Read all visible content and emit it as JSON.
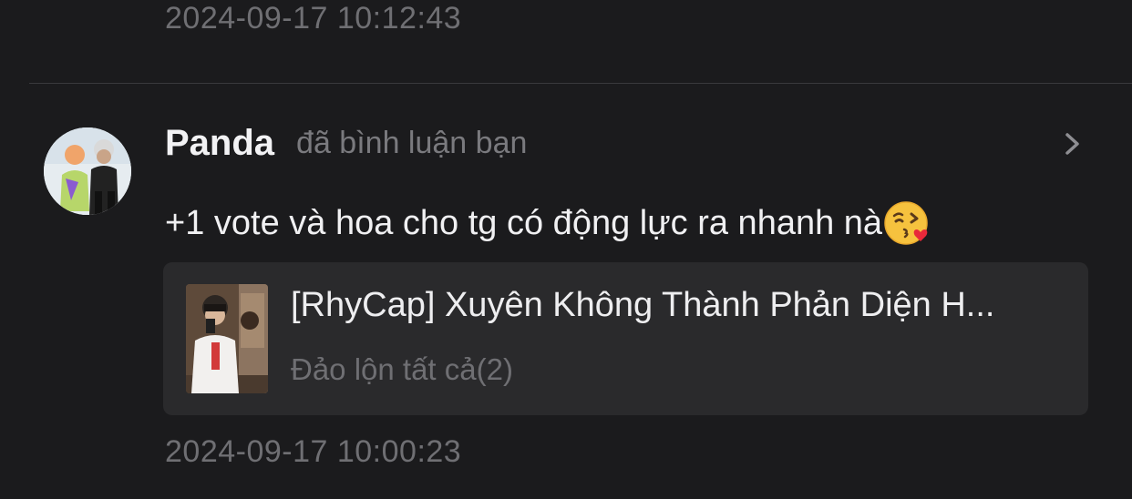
{
  "previous_notification": {
    "timestamp": "2024-09-17 10:12:43"
  },
  "notification": {
    "username": "Panda",
    "action_text": "đã bình luận bạn",
    "comment_text": "+1 vote và hoa cho tg có động lực ra nhanh nà",
    "comment_emoji": "kissing-face-with-heart-emoji",
    "timestamp": "2024-09-17 10:00:23",
    "avatar_icon": "user-avatar",
    "chevron_icon": "chevron-right-icon"
  },
  "story_card": {
    "title": "[RhyCap] Xuyên Không Thành Phản Diện H...",
    "subtitle": "Đảo lộn tất cả(2)",
    "thumbnail_icon": "story-cover-thumbnail"
  },
  "colors": {
    "background": "#1b1b1d",
    "card_background": "#2a2a2c",
    "primary_text": "#f2f2f4",
    "secondary_text": "#6f6f73",
    "divider": "#3a3a3d"
  }
}
